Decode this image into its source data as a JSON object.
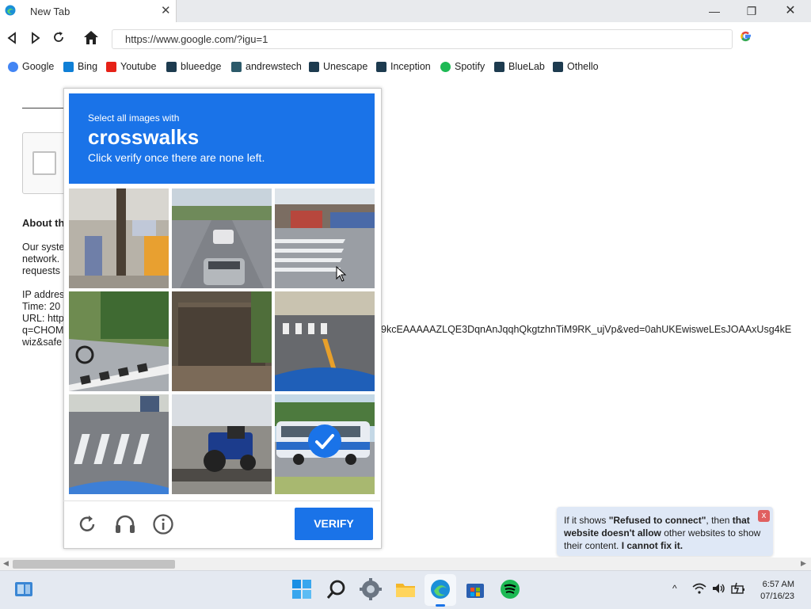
{
  "browser": {
    "tab_title": "New Tab",
    "tab_close": "✕",
    "address": "https://www.google.com/?igu=1",
    "window_minimize": "—",
    "window_restore": "❐",
    "window_close": "✕",
    "bookmarks": [
      {
        "label": "Google",
        "icon": "google-icon",
        "color": "#4285f4"
      },
      {
        "label": "Bing",
        "icon": "bing-icon",
        "color": "#0f7fd6"
      },
      {
        "label": "Youtube",
        "icon": "youtube-icon",
        "color": "#e62117"
      },
      {
        "label": "blueedge",
        "icon": "react-icon",
        "color": "#1d3b4f"
      },
      {
        "label": "andrewstech",
        "icon": "site-icon",
        "color": "#2c5a6a"
      },
      {
        "label": "Unescape",
        "icon": "react-icon",
        "color": "#1d3b4f"
      },
      {
        "label": "Inception",
        "icon": "react-icon",
        "color": "#1d3b4f"
      },
      {
        "label": "Spotify",
        "icon": "spotify-icon",
        "color": "#1db954"
      },
      {
        "label": "BlueLab",
        "icon": "react-icon",
        "color": "#1d3b4f"
      },
      {
        "label": "Othello",
        "icon": "react-icon",
        "color": "#1d3b4f"
      }
    ]
  },
  "background_page": {
    "heading": "About th",
    "para1_line1": "Our syste",
    "para1_line2": "network.",
    "para1_line3": "requests",
    "ip_line": "IP addres",
    "time_line": "Time: 20",
    "url_line": "URL: http",
    "q_line": "q=CHOM",
    "wiz_line": "wiz&safe",
    "url_tail": "9kcEAAAAAZLQE3DqnAnJqqhQkgtzhnTiM9RK_ujVp&ved=0ahUKEwisweLEsJOAAxUsg4kE"
  },
  "captcha": {
    "instruction_small": "Select all images with",
    "target": "crosswalks",
    "instruction_hint": "Click verify once there are none left.",
    "verify_label": "VERIFY",
    "tiles": [
      {
        "scene": "shop-front",
        "selected": false
      },
      {
        "scene": "road-cars",
        "selected": false
      },
      {
        "scene": "crosswalk-intersection",
        "selected": false
      },
      {
        "scene": "motorbike-curb",
        "selected": false
      },
      {
        "scene": "dumpster",
        "selected": false
      },
      {
        "scene": "crosswalk-street",
        "selected": false
      },
      {
        "scene": "crosswalk-car-hood",
        "selected": false
      },
      {
        "scene": "tractor-truck",
        "selected": false
      },
      {
        "scene": "bus",
        "selected": true
      }
    ]
  },
  "toast": {
    "text_prefix": "If it shows ",
    "text_bold1": "\"Refused to connect\"",
    "text_mid1": ", then ",
    "text_bold2": "that website doesn't allow",
    "text_mid2": " other websites to show their content. ",
    "text_bold3": "I cannot fix it.",
    "close": "x"
  },
  "taskbar": {
    "time": "6:57 AM",
    "date": "07/16/23"
  },
  "colors": {
    "accent": "#1a73e8",
    "toast_bg": "#dfe8f6"
  }
}
